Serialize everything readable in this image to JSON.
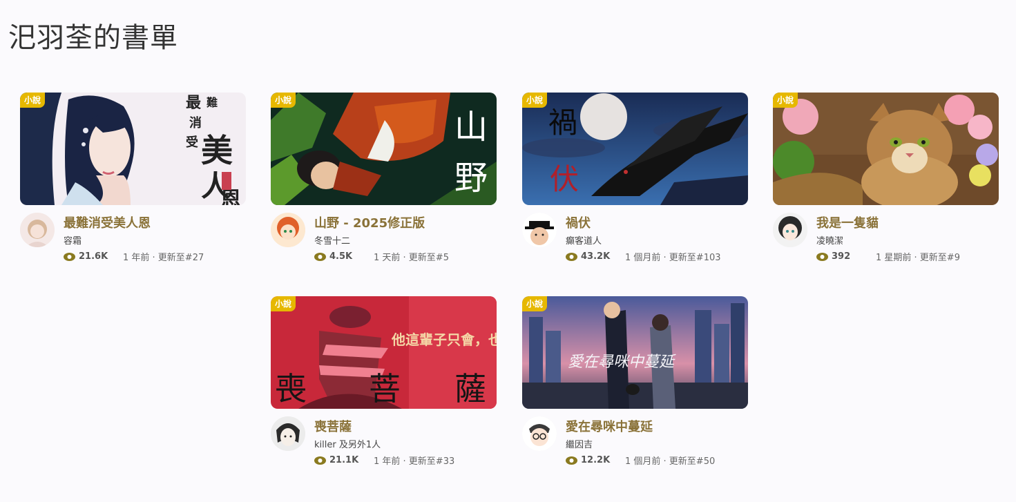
{
  "page": {
    "title": "汜羽荃的書單"
  },
  "badge_color": "#e6b800",
  "title_color": "#8a7238",
  "books": [
    {
      "badge": "小說",
      "title": "最難消受美人恩",
      "author": "容霜",
      "views": "21.6K",
      "updated": "1 年前 · 更新至#27",
      "cover_icon": "anime-woman-cover",
      "avatar_icon": "girl-avatar"
    },
    {
      "badge": "小說",
      "title": "山野 - 2025修正版",
      "author": "冬雪十二",
      "views": "4.5K",
      "updated": "1 天前 · 更新至#5",
      "cover_icon": "sleeping-man-cover",
      "cover_text": [
        "山",
        "野"
      ],
      "avatar_icon": "red-hair-avatar"
    },
    {
      "badge": "小說",
      "title": "禍伏",
      "author": "癲客道人",
      "views": "43.2K",
      "updated": "1 個月前 · 更新至#103",
      "cover_icon": "crow-moon-cover",
      "cover_text": [
        "禍",
        "伏"
      ],
      "avatar_icon": "hat-man-avatar"
    },
    {
      "badge": "小說",
      "title": "我是一隻貓",
      "author": "凌曉潔",
      "views": "392",
      "updated": "1 星期前 · 更新至#9",
      "cover_icon": "cat-flowers-cover",
      "avatar_icon": "dark-hair-avatar"
    },
    {
      "badge": "小說",
      "title": "喪菩薩",
      "author": "killer 及另外1人",
      "views": "21.1K",
      "updated": "1 年前 · 更新至#33",
      "cover_icon": "red-statue-cover",
      "cover_text": [
        "喪",
        "菩",
        "薩"
      ],
      "cover_slogan": "他這輩子只會，也只能和她在一起！",
      "avatar_icon": "sketch-avatar"
    },
    {
      "badge": "小說",
      "title": "愛在尋咪中蔓延",
      "author": "繼因吉",
      "views": "12.2K",
      "updated": "1 個月前 · 更新至#50",
      "cover_icon": "city-couple-cover",
      "cover_text": "愛在尋咪中蔓延",
      "avatar_icon": "glasses-avatar"
    }
  ]
}
